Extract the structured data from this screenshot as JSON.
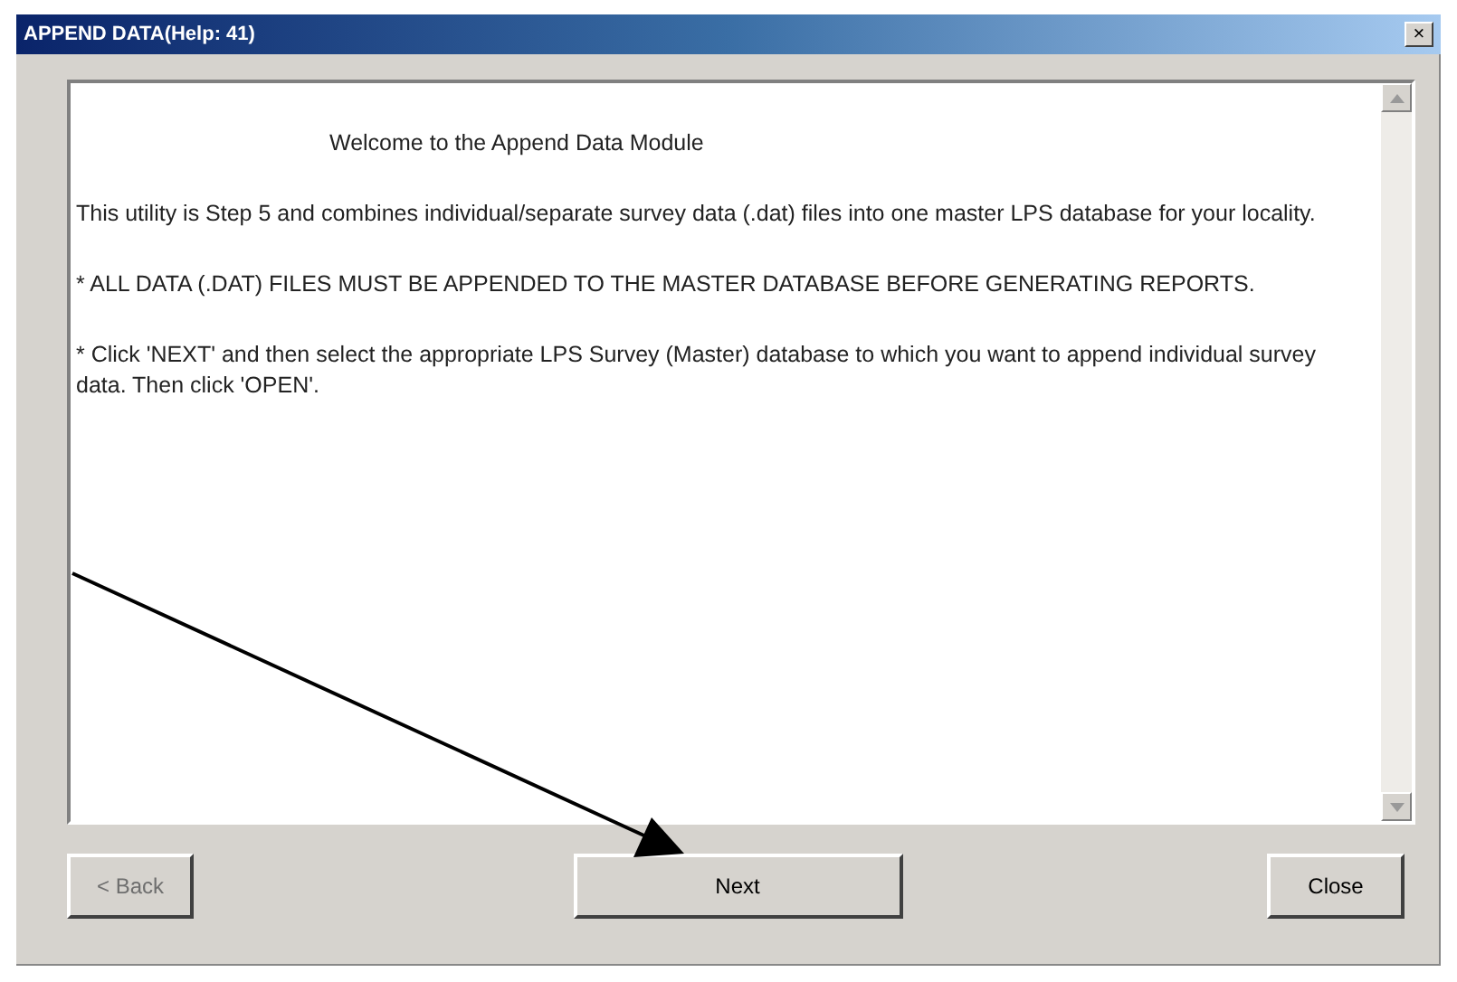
{
  "window": {
    "title": "APPEND DATA(Help: 41)",
    "close": "×"
  },
  "content": {
    "heading": "Welcome to the Append Data Module",
    "paragraphs": [
      "This utility is Step 5 and combines individual/separate survey data (.dat) files into one master LPS database for your locality.",
      "* ALL DATA (.DAT) FILES MUST BE APPENDED TO THE MASTER DATABASE BEFORE GENERATING REPORTS.",
      "* Click 'NEXT' and then select the appropriate LPS Survey (Master) database to which you want to append individual survey data.  Then click 'OPEN'."
    ]
  },
  "buttons": [
    {
      "label": "< Back",
      "disabled": true
    },
    {
      "label": "Next",
      "disabled": false
    },
    {
      "label": "Close",
      "disabled": false
    }
  ]
}
